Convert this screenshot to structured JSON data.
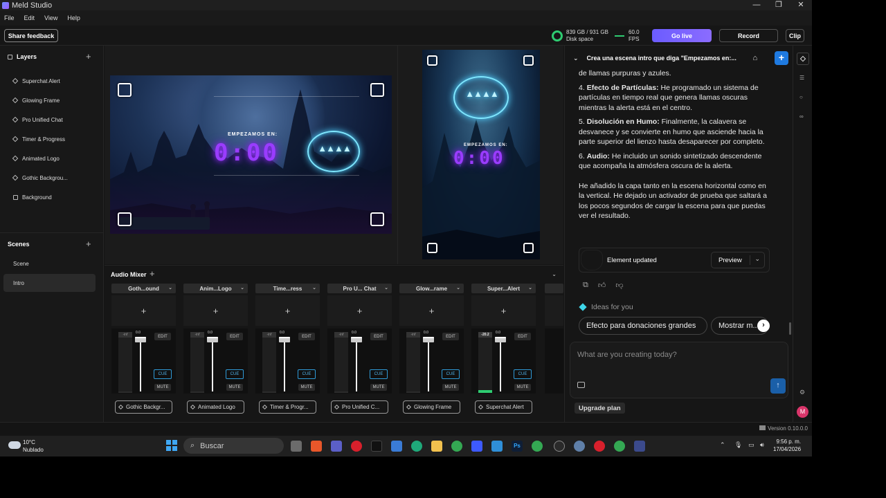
{
  "window": {
    "title": "Meld Studio",
    "controls": {
      "minimize": "—",
      "maximize": "❐",
      "close": "✕"
    }
  },
  "menu": [
    "File",
    "Edit",
    "View",
    "Help"
  ],
  "toolbar": {
    "share_feedback": "Share feedback",
    "disk": {
      "value": "839 GB / 931 GB",
      "label": "Disk space"
    },
    "fps": {
      "value": "60.0",
      "label": "FPS"
    },
    "go_live": "Go live",
    "record": "Record",
    "clip": "Clip"
  },
  "layers": {
    "title": "Layers",
    "items": [
      {
        "label": "Superchat Alert",
        "icon": "diamond-icon"
      },
      {
        "label": "Glowing Frame",
        "icon": "diamond-icon"
      },
      {
        "label": "Pro Unified Chat",
        "icon": "diamond-icon"
      },
      {
        "label": "Timer & Progress",
        "icon": "diamond-icon"
      },
      {
        "label": "Animated Logo",
        "icon": "diamond-icon"
      },
      {
        "label": "Gothic Backgrou...",
        "icon": "diamond-icon"
      },
      {
        "label": "Background",
        "icon": "square-icon"
      }
    ]
  },
  "scenes": {
    "title": "Scenes",
    "items": [
      {
        "label": "Scene",
        "active": false
      },
      {
        "label": "Intro",
        "active": true
      }
    ]
  },
  "preview": {
    "horizontal": {
      "heading": "EMPEZAMOS EN:",
      "timer": "0:00"
    },
    "vertical": {
      "heading": "EMPEZAMOS EN:",
      "timer": "0:00"
    }
  },
  "mixer": {
    "title": "Audio Mixer",
    "channels": [
      {
        "head": "Goth...ound",
        "level": "-inf",
        "fader": "0.0",
        "edit": "EDIT",
        "cue": "CUE",
        "mute": "MUTE",
        "foot": "Gothic Backgr..."
      },
      {
        "head": "Anim...Logo",
        "level": "-inf",
        "fader": "0.0",
        "edit": "EDIT",
        "cue": "CUE",
        "mute": "MUTE",
        "foot": "Animated Logo"
      },
      {
        "head": "Time...ress",
        "level": "-inf",
        "fader": "0.0",
        "edit": "EDIT",
        "cue": "CUE",
        "mute": "MUTE",
        "foot": "Timer & Progr..."
      },
      {
        "head": "Pro U... Chat",
        "level": "-inf",
        "fader": "0.0",
        "edit": "EDIT",
        "cue": "CUE",
        "mute": "MUTE",
        "foot": "Pro Unified C..."
      },
      {
        "head": "Glow...rame",
        "level": "-inf",
        "fader": "0.0",
        "edit": "EDIT",
        "cue": "CUE",
        "mute": "MUTE",
        "foot": "Glowing Frame"
      },
      {
        "head": "Super...Alert",
        "level": "-20.2",
        "fader": "0.0",
        "edit": "EDIT",
        "cue": "CUE",
        "mute": "MUTE",
        "foot": "Superchat Alert"
      }
    ]
  },
  "chat": {
    "title": "Crea una escena intro que diga \"Empezamos en:...",
    "intro_line": "de llamas purpuras y azules.",
    "items": [
      {
        "num": "4.",
        "bold": "Efecto de Partículas:",
        "text": " He programado un sistema de partículas en tiempo real que genera llamas oscuras mientras la alerta está en el centro."
      },
      {
        "num": "5.",
        "bold": "Disolución en Humo:",
        "text": " Finalmente, la calavera se desvanece y se convierte en humo que asciende hacia la parte superior del lienzo hasta desaparecer por completo."
      },
      {
        "num": "6.",
        "bold": "Audio:",
        "text": " He incluido un sonido sintetizado descendente que acompaña la atmósfera oscura de la alerta."
      }
    ],
    "closing": "He añadido la capa tanto en la escena horizontal como en la vertical. He dejado un activador de prueba que saltará a los pocos segundos de cargar la escena para que puedas ver el resultado.",
    "element_card": {
      "label": "Element updated",
      "preview": "Preview"
    },
    "ideas_label": "Ideas for you",
    "chips": [
      "Efecto para donaciones grandes",
      "Mostrar m..."
    ],
    "input_placeholder": "What are you creating today?",
    "upgrade": "Upgrade plan"
  },
  "avatar_letter": "M",
  "version": "Version 0.10.0.0",
  "taskbar": {
    "weather": {
      "temp": "10°C",
      "cond": "Nublado"
    },
    "search": "Buscar",
    "time": "9:56 p. m.",
    "date": "17/04/2026"
  },
  "colors": {
    "accent": "#1f7ae0",
    "golive": "#7b63ff",
    "cue": "#2f9bd8",
    "timer": "#9a3cff",
    "logo_glow": "#4fd0ff"
  }
}
